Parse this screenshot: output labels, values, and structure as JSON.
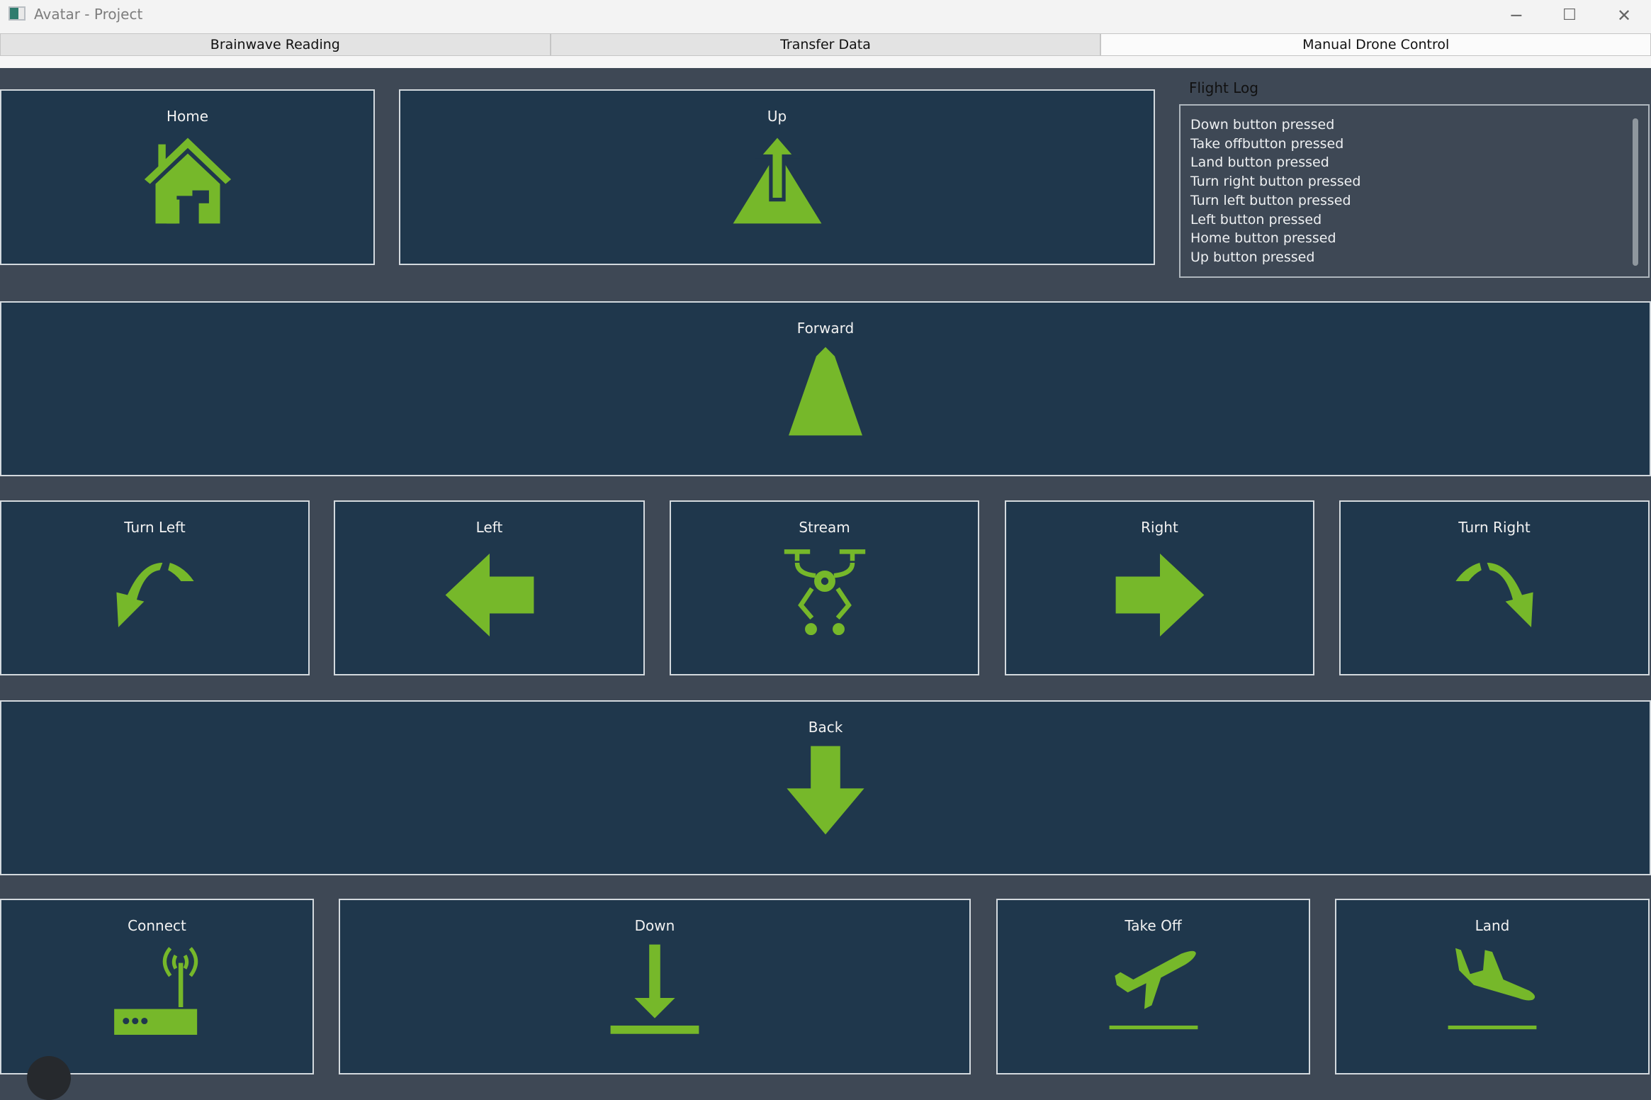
{
  "window": {
    "title": "Avatar - Project",
    "minimize": "─",
    "maximize": "☐",
    "close": "✕"
  },
  "tabs": [
    {
      "label": "Brainwave Reading"
    },
    {
      "label": "Transfer Data"
    },
    {
      "label": "Manual Drone Control",
      "active": true
    }
  ],
  "controls": {
    "home": "Home",
    "up": "Up",
    "forward": "Forward",
    "turn_left": "Turn Left",
    "left": "Left",
    "stream": "Stream",
    "right": "Right",
    "turn_right": "Turn Right",
    "back": "Back",
    "connect": "Connect",
    "down": "Down",
    "take_off": "Take Off",
    "land": "Land"
  },
  "flight_log": {
    "label": "Flight Log",
    "entries": [
      "Down button pressed",
      "Take offbutton pressed",
      "Land button pressed",
      "Turn right button pressed",
      "Turn left button pressed",
      "Left button pressed",
      "Home button pressed",
      "Up button pressed"
    ]
  },
  "colors": {
    "icon": "#76b82a",
    "panel": "#1f374c",
    "background": "#3e4855"
  }
}
